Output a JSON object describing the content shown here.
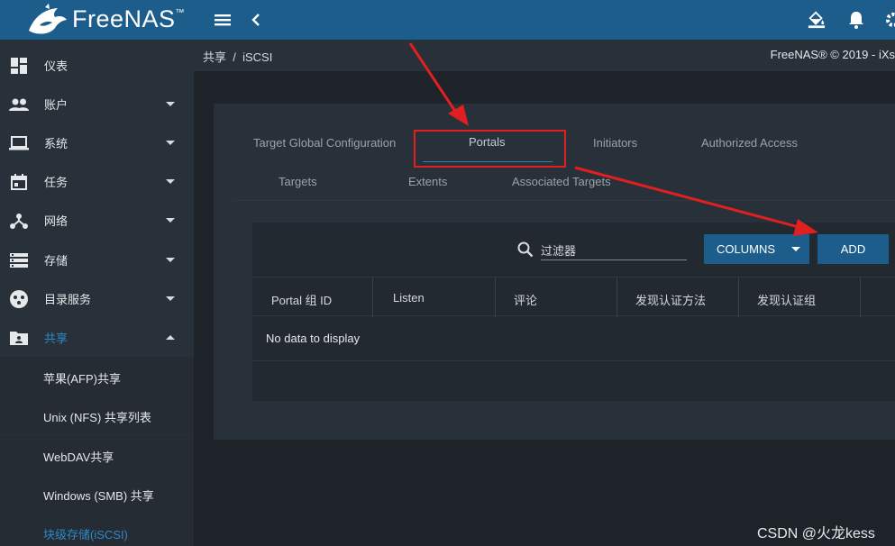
{
  "header": {
    "logo_text": "FreeNAS",
    "menu_icon": "menu-icon",
    "collapse_icon": "chevron-left-icon",
    "theme_icon": "paint-bucket-icon",
    "notifications_icon": "bell-icon",
    "settings_icon": "gear-icon"
  },
  "sidebar": {
    "items": [
      {
        "label": "仪表",
        "icon": "dashboard-icon",
        "has_caret": false
      },
      {
        "label": "账户",
        "icon": "people-icon",
        "has_caret": true
      },
      {
        "label": "系统",
        "icon": "laptop-icon",
        "has_caret": true
      },
      {
        "label": "任务",
        "icon": "calendar-icon",
        "has_caret": true
      },
      {
        "label": "网络",
        "icon": "network-icon",
        "has_caret": true
      },
      {
        "label": "存储",
        "icon": "storage-icon",
        "has_caret": true
      },
      {
        "label": "目录服务",
        "icon": "directory-icon",
        "has_caret": true
      },
      {
        "label": "共享",
        "icon": "folder-share-icon",
        "has_caret": true,
        "expanded": true,
        "active": true
      }
    ],
    "subitems": [
      {
        "label": "苹果(AFP)共享"
      },
      {
        "label": "Unix (NFS) 共享列表"
      },
      {
        "label": "WebDAV共享"
      },
      {
        "label": "Windows (SMB) 共享"
      },
      {
        "label": "块级存储(iSCSI)",
        "active": true
      }
    ]
  },
  "breadcrumb": {
    "parent": "共享",
    "separator": "/",
    "current": "iSCSI"
  },
  "copyright": "FreeNAS® © 2019 - iXs",
  "tabs": {
    "row1": [
      "Target Global Configuration",
      "Portals",
      "Initiators",
      "Authorized Access"
    ],
    "row2": [
      "Targets",
      "Extents",
      "Associated Targets"
    ],
    "active": "Portals"
  },
  "toolbar": {
    "filter_placeholder": "过滤器",
    "columns_label": "COLUMNS",
    "add_label": "ADD"
  },
  "table": {
    "columns": [
      "Portal 组 ID",
      "Listen",
      "评论",
      "发现认证方法",
      "发现认证组"
    ],
    "empty_message": "No data to display"
  },
  "annotation_color": "#e02020",
  "accent_color": "#1c5d8c",
  "watermark": "CSDN @火龙kess"
}
